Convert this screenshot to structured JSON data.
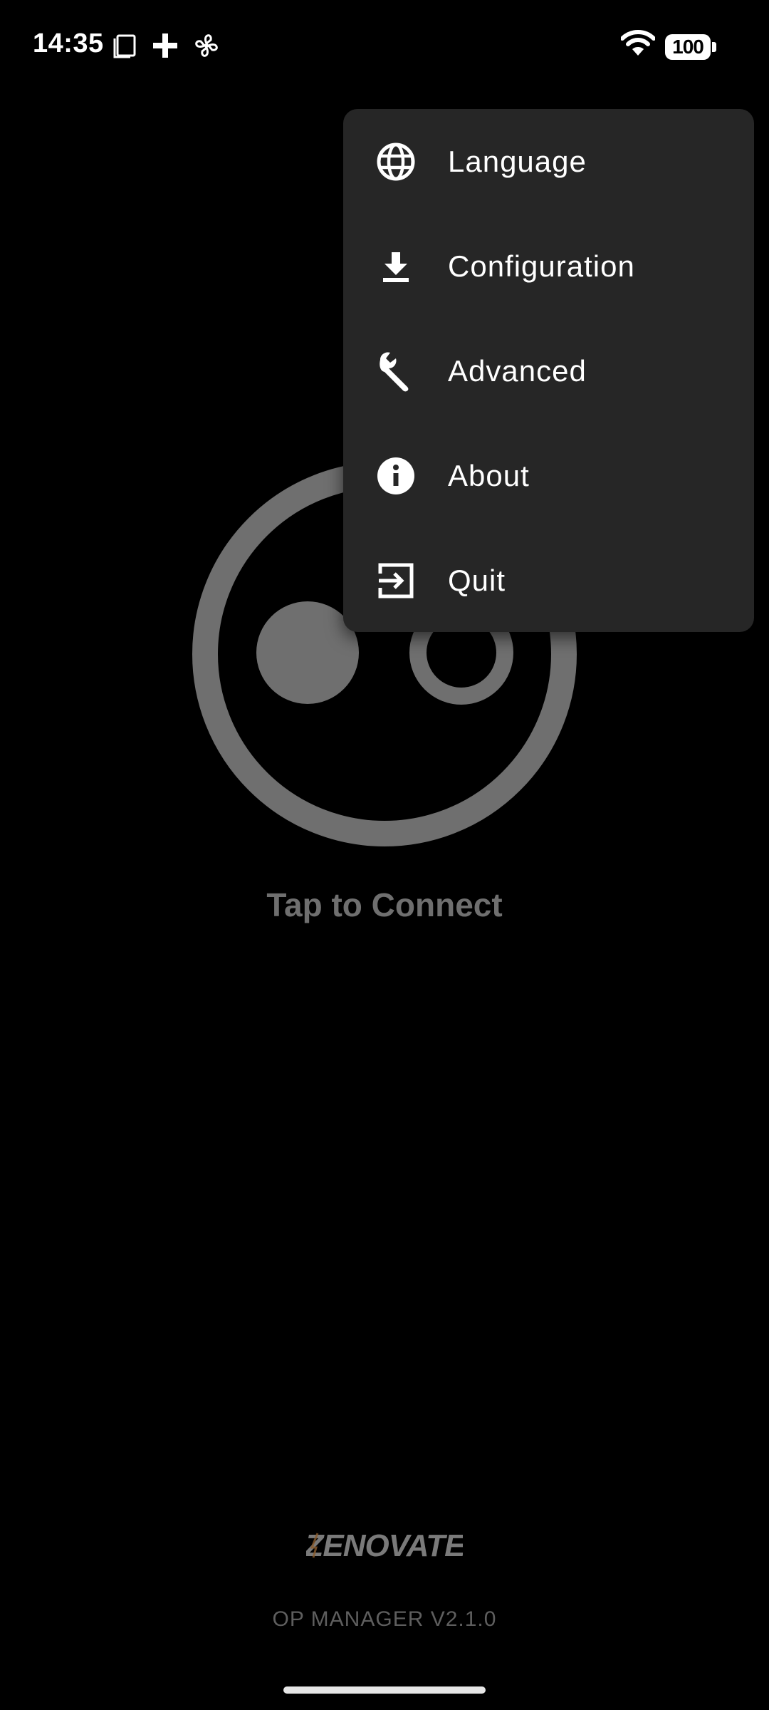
{
  "status_bar": {
    "time": "14:35",
    "battery": "100",
    "icons": [
      "screenshot-icon",
      "plus-icon",
      "fan-icon",
      "wifi-icon",
      "battery-icon"
    ]
  },
  "menu": {
    "items": [
      {
        "label": "Language",
        "icon": "globe-icon"
      },
      {
        "label": "Configuration",
        "icon": "download-icon"
      },
      {
        "label": "Advanced",
        "icon": "wrench-icon"
      },
      {
        "label": "About",
        "icon": "info-icon"
      },
      {
        "label": "Quit",
        "icon": "exit-icon"
      }
    ]
  },
  "main": {
    "connect_label": "Tap to Connect",
    "graphic_color": "#6f6f6f"
  },
  "footer": {
    "brand": "ZENOVATE",
    "version": "OP MANAGER V2.1.0"
  }
}
